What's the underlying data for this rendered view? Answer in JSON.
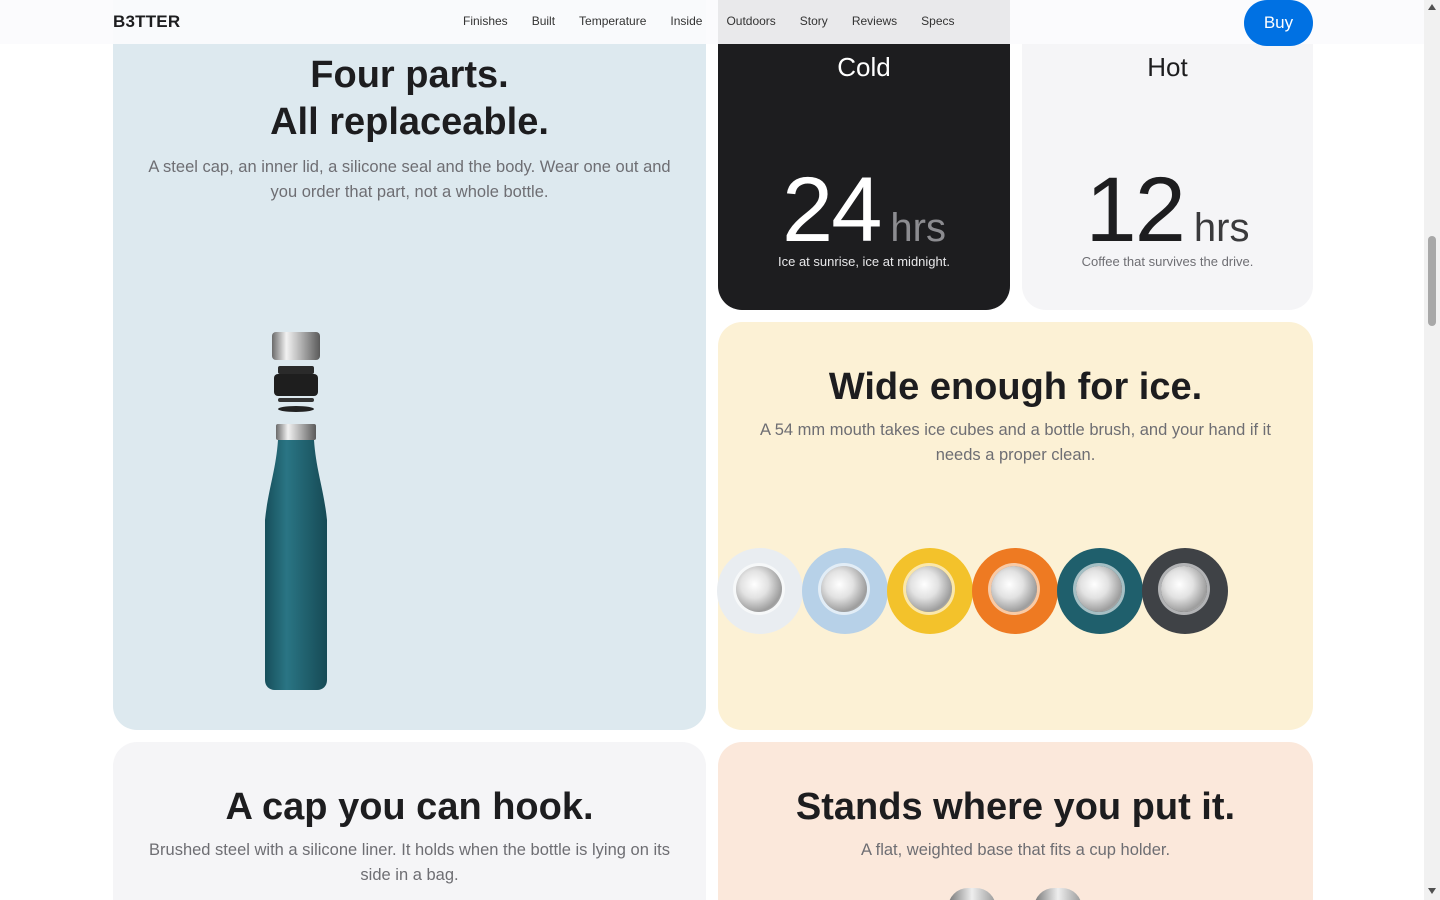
{
  "nav": {
    "logo": "B3TTER",
    "links": [
      "Finishes",
      "Built",
      "Temperature",
      "Inside",
      "Outdoors",
      "Story",
      "Reviews",
      "Specs"
    ],
    "buy_label": "Buy"
  },
  "parts": {
    "title_line1": "Four parts.",
    "title_line2": "All replaceable.",
    "desc_line1": "A steel cap, an inner lid, a silicone seal and the body. Wear one out and",
    "desc_line2": "you order that part, not a whole bottle."
  },
  "cold": {
    "label": "Cold",
    "value": "24",
    "unit": "hrs",
    "note": "Ice at sunrise, ice at midnight."
  },
  "hot": {
    "label": "Hot",
    "value": "12",
    "unit": "hrs",
    "note": "Coffee that survives the drive."
  },
  "wide": {
    "title": "Wide enough for ice.",
    "desc_line1": "A 54 mm mouth takes ice cubes and a bottle brush, and your hand if it",
    "desc_line2": "needs a proper clean.",
    "lid_colors": [
      "#e9edf1",
      "#b7d1e8",
      "#f3c22b",
      "#ee7a22",
      "#1f5f6c",
      "#3f4246"
    ]
  },
  "cap": {
    "title": "A cap you can hook.",
    "desc_line1": "Brushed steel with a silicone liner. It holds when the bottle is lying on its",
    "desc_line2": "side in a bag."
  },
  "stand": {
    "title": "Stands where you put it.",
    "desc": "A flat, weighted base that fits a cup holder."
  },
  "colors": {
    "accent": "#0071e3",
    "bottle": "#1f6676"
  }
}
